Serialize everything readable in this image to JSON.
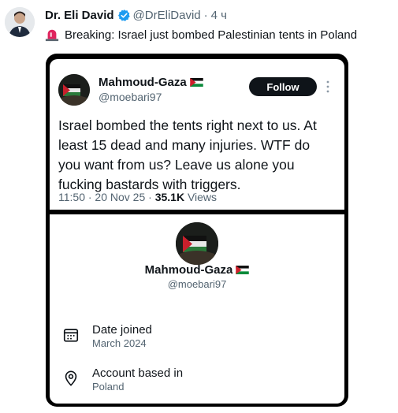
{
  "post": {
    "author_name": "Dr. Eli David",
    "author_handle": "@DrEliDavid",
    "separator": "·",
    "time": "4 ч",
    "text": "Breaking: Israel just bombed Palestinian tents in Poland",
    "icons": {
      "verified": "verified-badge-icon",
      "siren": "siren-icon"
    }
  },
  "quoted_tweet": {
    "name": "Mahmoud-Gaza",
    "handle": "@moebari97",
    "follow_label": "Follow",
    "text": "Israel bombed the tents right next to us. At least 15 dead and many injuries. WTF do you want from us? Leave us alone you fucking bastards with triggers.",
    "timestamp": "11:50 · 20 Nov 25 · ",
    "views_count": "35.1K",
    "views_label": " Views"
  },
  "profile_card": {
    "name": "Mahmoud-Gaza",
    "handle": "@moebari97",
    "date_joined_label": "Date joined",
    "date_joined_value": "March 2024",
    "account_based_label": "Account based in",
    "account_based_value": "Poland"
  },
  "colors": {
    "text": "#0f1419",
    "muted": "#536471",
    "verified": "#1d9bf0",
    "siren": "#e0245e",
    "frame": "#000000"
  }
}
